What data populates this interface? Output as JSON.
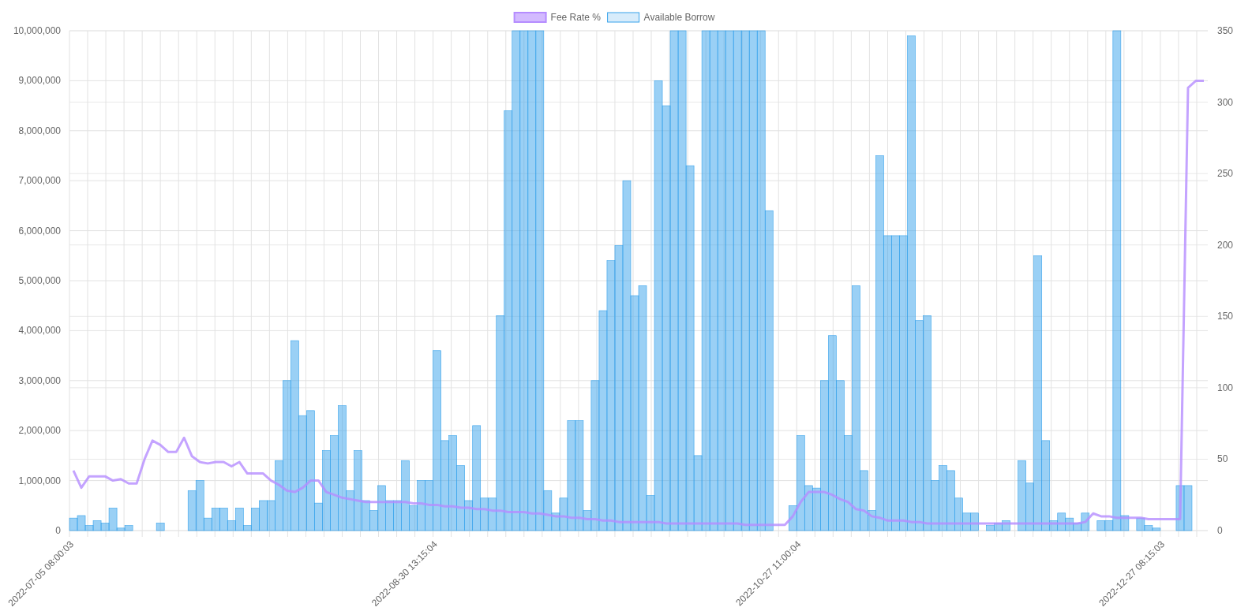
{
  "chart_data": {
    "type": "bar",
    "categories": [
      "2022-07-05 08:00:03",
      null,
      null,
      null,
      null,
      null,
      null,
      null,
      null,
      null,
      null,
      null,
      null,
      null,
      null,
      null,
      null,
      null,
      null,
      null,
      null,
      null,
      null,
      null,
      null,
      null,
      null,
      null,
      null,
      null,
      null,
      null,
      null,
      null,
      null,
      null,
      null,
      null,
      null,
      null,
      null,
      null,
      null,
      null,
      null,
      null,
      "2022-08-30 13:15:04",
      null,
      null,
      null,
      null,
      null,
      null,
      null,
      null,
      null,
      null,
      null,
      null,
      null,
      null,
      null,
      null,
      null,
      null,
      null,
      null,
      null,
      null,
      null,
      null,
      null,
      null,
      null,
      null,
      null,
      null,
      null,
      null,
      null,
      null,
      null,
      null,
      null,
      null,
      null,
      null,
      null,
      null,
      null,
      null,
      null,
      "2022-10-27 11:00:04",
      null,
      null,
      null,
      null,
      null,
      null,
      null,
      null,
      null,
      null,
      null,
      null,
      null,
      null,
      null,
      null,
      null,
      null,
      null,
      null,
      null,
      null,
      null,
      null,
      null,
      null,
      null,
      null,
      null,
      null,
      null,
      null,
      null,
      null,
      null,
      null,
      null,
      null,
      null,
      null,
      null,
      null,
      null,
      null,
      null,
      "2022-12-27 08:15:03",
      null,
      null,
      null,
      null,
      null
    ],
    "grid": true,
    "legend": "top",
    "ylim": [
      0,
      10000000
    ],
    "yticks": [
      {
        "value": 0,
        "label": "0"
      },
      {
        "value": 1000000,
        "label": "1,000,000"
      },
      {
        "value": 2000000,
        "label": "2,000,000"
      },
      {
        "value": 3000000,
        "label": "3,000,000"
      },
      {
        "value": 4000000,
        "label": "4,000,000"
      },
      {
        "value": 5000000,
        "label": "5,000,000"
      },
      {
        "value": 6000000,
        "label": "6,000,000"
      },
      {
        "value": 7000000,
        "label": "7,000,000"
      },
      {
        "value": 8000000,
        "label": "8,000,000"
      },
      {
        "value": 9000000,
        "label": "9,000,000"
      },
      {
        "value": 10000000,
        "label": "10,000,000"
      }
    ],
    "y2lim": [
      0,
      350
    ],
    "y2ticks": [
      {
        "value": 0,
        "label": "0"
      },
      {
        "value": 50,
        "label": "50"
      },
      {
        "value": 100,
        "label": "100"
      },
      {
        "value": 150,
        "label": "150"
      },
      {
        "value": 200,
        "label": "200"
      },
      {
        "value": 250,
        "label": "250"
      },
      {
        "value": 300,
        "label": "300"
      },
      {
        "value": 350,
        "label": "350"
      }
    ],
    "series": [
      {
        "name": "Fee Rate %",
        "type": "line",
        "axis": "y2",
        "color": "#b58cff",
        "values": [
          42,
          30,
          38,
          38,
          38,
          35,
          36,
          33,
          33,
          50,
          63,
          60,
          55,
          55,
          65,
          52,
          48,
          47,
          48,
          48,
          45,
          48,
          40,
          40,
          40,
          35,
          32,
          28,
          27,
          30,
          35,
          35,
          27,
          25,
          23,
          22,
          21,
          20,
          20,
          20,
          20,
          20,
          20,
          19,
          19,
          18,
          18,
          17,
          17,
          16,
          16,
          15,
          15,
          14,
          14,
          13,
          13,
          13,
          12,
          12,
          11,
          10,
          10,
          9,
          9,
          8,
          8,
          7,
          7,
          6,
          6,
          6,
          6,
          6,
          6,
          5,
          5,
          5,
          5,
          5,
          5,
          5,
          5,
          5,
          5,
          4,
          4,
          4,
          4,
          4,
          4,
          10,
          20,
          27,
          27,
          27,
          25,
          22,
          20,
          15,
          14,
          10,
          9,
          7,
          7,
          7,
          6,
          6,
          5,
          5,
          5,
          5,
          5,
          5,
          5,
          5,
          5,
          5,
          5,
          5,
          5,
          5,
          5,
          5,
          5,
          5,
          5,
          5,
          6,
          12,
          10,
          10,
          9,
          9,
          9,
          9,
          8,
          8,
          8,
          8,
          8,
          310,
          315,
          315
        ]
      },
      {
        "name": "Available Borrow",
        "color": "#36a2eb",
        "values": [
          250000,
          300000,
          100000,
          200000,
          150000,
          450000,
          50000,
          100000,
          0,
          0,
          0,
          150000,
          0,
          0,
          0,
          800000,
          1000000,
          250000,
          450000,
          450000,
          200000,
          450000,
          100000,
          450000,
          600000,
          600000,
          1400000,
          3000000,
          3800000,
          2300000,
          2400000,
          550000,
          1600000,
          1900000,
          2500000,
          800000,
          1600000,
          600000,
          400000,
          900000,
          600000,
          600000,
          1400000,
          500000,
          1000000,
          1000000,
          3600000,
          1800000,
          1900000,
          1300000,
          600000,
          2100000,
          650000,
          650000,
          4300000,
          8400000,
          10000000,
          10000000,
          10000000,
          10000000,
          800000,
          350000,
          650000,
          2200000,
          2200000,
          400000,
          3000000,
          4400000,
          5400000,
          5700000,
          7000000,
          4700000,
          4900000,
          700000,
          9000000,
          8500000,
          10000000,
          10000000,
          7300000,
          1500000,
          10000000,
          10000000,
          10000000,
          10000000,
          10000000,
          10000000,
          10000000,
          10000000,
          6400000,
          0,
          0,
          500000,
          1900000,
          900000,
          850000,
          3000000,
          3900000,
          3000000,
          1900000,
          4900000,
          1200000,
          400000,
          7500000,
          5900000,
          5900000,
          5900000,
          9900000,
          4200000,
          4300000,
          1000000,
          1300000,
          1200000,
          650000,
          350000,
          350000,
          0,
          100000,
          150000,
          200000,
          0,
          1400000,
          950000,
          5500000,
          1800000,
          200000,
          350000,
          250000,
          150000,
          350000,
          0,
          200000,
          200000,
          10000000,
          300000,
          0,
          250000,
          100000,
          50000,
          0,
          0,
          900000,
          900000,
          0,
          0
        ]
      }
    ]
  }
}
